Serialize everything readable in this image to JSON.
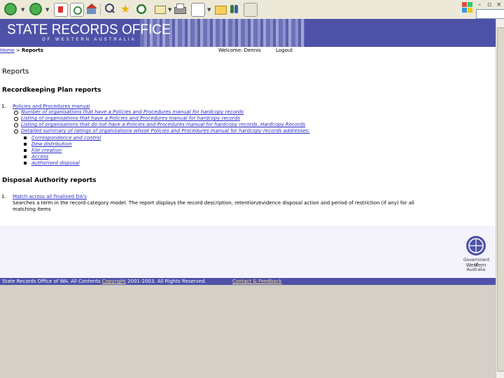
{
  "banner": {
    "title": "STATE RECORDS OFFICE",
    "subtitle": "OF WESTERN AUSTRALIA"
  },
  "subbar": {
    "crumb_home": "Home",
    "crumb_sep": " > ",
    "crumb_current": "Reports",
    "welcome": "Welcome: Dennis",
    "logout": "Logout"
  },
  "page": {
    "title": "Reports"
  },
  "sections": {
    "rkp_title": "Recordkeeping Plan reports",
    "rkp_item1_num": "1.",
    "rkp_item1_link": "Policies and Procedures manual",
    "rkp_bullets": [
      "Number of organisations that have a Policies and Procedures manual for hardcopy records",
      "Listing of organisations that have a Policies and Procedures manual for hardcopy records",
      "Listing of organisations that do not have a Policies and Procedures manual for hardcopy records. Hardcopy Records",
      "Detailed summary of ratings of organisations whose Policies and Procedures manual for hardcopy records addresses:"
    ],
    "rkp_subbullets": [
      "Correspondence and control",
      "Dew distribution",
      "File creation",
      "Access",
      "Authorised disposal"
    ],
    "da_title": "Disposal Authority reports",
    "da_item1_num": "1.",
    "da_item1_link": "Match across all finalised DA's",
    "da_item1_desc_1": "Searches a term in the record category model. The report displays the record description, retention/evidence disposal action and period of restriction (if any) for all",
    "da_item1_desc_2": "matching items"
  },
  "gov": {
    "line1": "Government of",
    "line2": "Western",
    "line3": "Australia"
  },
  "footer": {
    "text": "State Records Office of WA. All Contents ",
    "copyright": "Copyright",
    "years": " 2001-2003. All Rights Reserved.",
    "contact": "Contact & Feedback"
  },
  "colors": {
    "banner": "#4d52a8",
    "link": "#2b2bc8",
    "footer_link": "#ffe08a"
  }
}
